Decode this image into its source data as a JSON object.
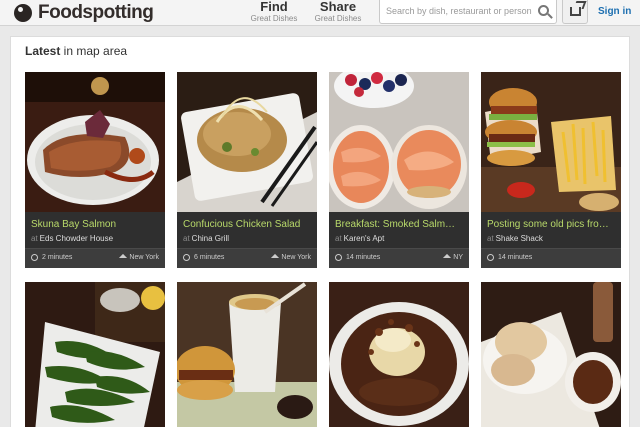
{
  "header": {
    "logo": "Foodspotting",
    "nav": [
      {
        "label": "Find",
        "sub": "Great Dishes"
      },
      {
        "label": "Share",
        "sub": "Great Dishes"
      }
    ],
    "search_placeholder": "Search by dish, restaurant or person",
    "signin": "Sign in"
  },
  "section": {
    "title_bold": "Latest",
    "title_rest": " in map area"
  },
  "cards": [
    {
      "dish": "Skuna Bay Salmon",
      "at": "at",
      "place": "Eds Chowder House",
      "time": "2 minutes",
      "location": "New York"
    },
    {
      "dish": "Confucious Chicken Salad",
      "at": "at",
      "place": "China Grill",
      "time": "6 minutes",
      "location": "New York"
    },
    {
      "dish": "Breakfast: Smoked Salm…",
      "at": "at",
      "place": "Karen's Apt",
      "time": "14 minutes",
      "location": "NY"
    },
    {
      "dish": "Posting some old pics fro…",
      "at": "at",
      "place": "Shake Shack",
      "time": "14 minutes",
      "location": ""
    }
  ]
}
